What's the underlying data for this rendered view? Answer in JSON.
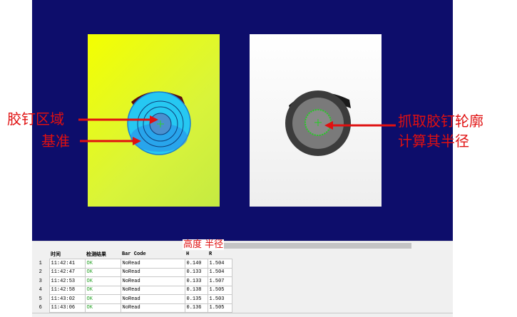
{
  "annotations": {
    "glue_region": "胶钉区域",
    "reference": "基准",
    "capture_line1": "抓取胶钉轮廓",
    "capture_line2": "计算其半径",
    "height_radius": "高度 半径"
  },
  "colors": {
    "viewer_bg": "#0d0d6b",
    "annotation": "#e01010",
    "ok": "#22a022"
  },
  "table": {
    "headers": [
      "",
      "时间",
      "检测结果",
      "Bar Code",
      "H",
      "R"
    ],
    "rows": [
      {
        "idx": "1",
        "time": "11:42:41",
        "result": "OK",
        "barcode": "NoRead",
        "h": "0.140",
        "r": "1.504"
      },
      {
        "idx": "2",
        "time": "11:42:47",
        "result": "OK",
        "barcode": "NoRead",
        "h": "0.133",
        "r": "1.504"
      },
      {
        "idx": "3",
        "time": "11:42:53",
        "result": "OK",
        "barcode": "NoRead",
        "h": "0.133",
        "r": "1.507"
      },
      {
        "idx": "4",
        "time": "11:42:58",
        "result": "OK",
        "barcode": "NoRead",
        "h": "0.138",
        "r": "1.505"
      },
      {
        "idx": "5",
        "time": "11:43:02",
        "result": "OK",
        "barcode": "NoRead",
        "h": "0.135",
        "r": "1.503"
      },
      {
        "idx": "6",
        "time": "11:43:06",
        "result": "OK",
        "barcode": "NoRead",
        "h": "0.136",
        "r": "1.505"
      }
    ]
  }
}
